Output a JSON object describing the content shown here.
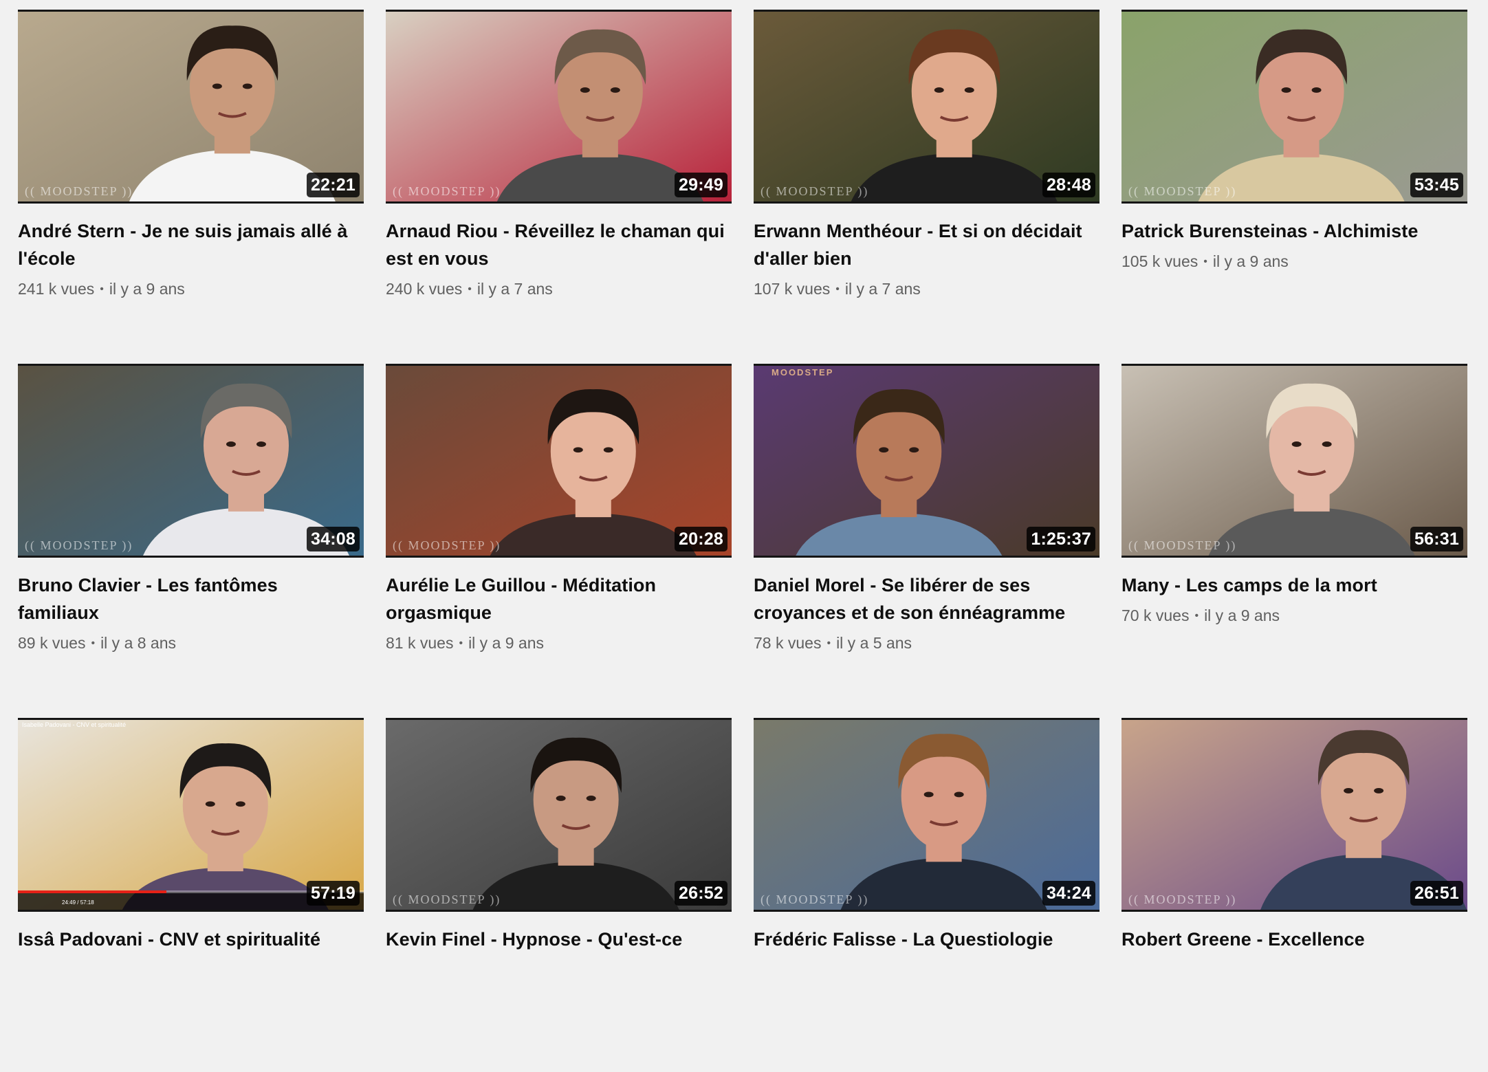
{
  "videos": [
    {
      "title": "André Stern - Je ne suis jamais allé à l'école",
      "views": "241 k vues",
      "age": "il y a 9 ans",
      "duration": "22:21",
      "watermark": "(( MOODSTEP ))",
      "scene": {
        "bg": "#b8a98e",
        "bg2": "#8e836e",
        "skin": "#c99a7c",
        "hair": "#2a1e16",
        "shirt": "#f4f4f4",
        "face_cx": 0.62,
        "face_cy": 0.4
      }
    },
    {
      "title": "Arnaud Riou - Réveillez le chaman qui est en vous",
      "views": "240 k vues",
      "age": "il y a 7 ans",
      "duration": "29:49",
      "watermark": "(( MOODSTEP ))",
      "scene": {
        "bg": "#d8d0c2",
        "bg2": "#b8223a",
        "skin": "#c38f73",
        "hair": "#6d5a49",
        "shirt": "#4a4a4a",
        "face_cx": 0.62,
        "face_cy": 0.42
      }
    },
    {
      "title": "Erwann Menthéour - Et si on décidait d'aller bien",
      "views": "107 k vues",
      "age": "il y a 7 ans",
      "duration": "28:48",
      "watermark": "(( MOODSTEP ))",
      "scene": {
        "bg": "#6b5a3a",
        "bg2": "#2e3a22",
        "skin": "#e0a98c",
        "hair": "#6a3a20",
        "shirt": "#1e1e1e",
        "face_cx": 0.58,
        "face_cy": 0.42
      }
    },
    {
      "title": "Patrick Burensteinas - Alchimiste",
      "views": "105 k vues",
      "age": "il y a 9 ans",
      "duration": "53:45",
      "watermark": "(( MOODSTEP ))",
      "scene": {
        "bg": "#8aa36a",
        "bg2": "#9a9a92",
        "skin": "#d69a86",
        "hair": "#3a2c24",
        "shirt": "#d8c8a0",
        "face_cx": 0.52,
        "face_cy": 0.42
      }
    },
    {
      "title": "Bruno Clavier - Les fantômes familiaux",
      "views": "89 k vues",
      "age": "il y a 8 ans",
      "duration": "34:08",
      "watermark": "(( MOODSTEP ))",
      "scene": {
        "bg": "#5a5242",
        "bg2": "#3a6a8a",
        "skin": "#d8a894",
        "hair": "#6a6a66",
        "shirt": "#e8e8ec",
        "face_cx": 0.66,
        "face_cy": 0.42
      }
    },
    {
      "title": "Aurélie Le Guillou - Méditation orgasmique",
      "views": "81 k vues",
      "age": "il y a 9 ans",
      "duration": "20:28",
      "watermark": "(( MOODSTEP ))",
      "scene": {
        "bg": "#6a4a3a",
        "bg2": "#a8442a",
        "skin": "#e6b49c",
        "hair": "#1e1612",
        "shirt": "#3a2a28",
        "face_cx": 0.6,
        "face_cy": 0.45
      }
    },
    {
      "title": "Daniel Morel - Se libérer de ses croyances et de son énnéagramme",
      "views": "78 k vues",
      "age": "il y a 5 ans",
      "duration": "1:25:37",
      "watermark": "MOODSTEP",
      "scene": {
        "bg": "#5a3a72",
        "bg2": "#4a3a28",
        "skin": "#b87a5a",
        "hair": "#3a2818",
        "shirt": "#6a88a8",
        "face_cx": 0.42,
        "face_cy": 0.45
      }
    },
    {
      "title": "Many - Les camps de la mort",
      "views": "70 k vues",
      "age": "il y a 9 ans",
      "duration": "56:31",
      "watermark": "(( MOODSTEP ))",
      "scene": {
        "bg": "#c8c0b4",
        "bg2": "#6a5a4a",
        "skin": "#e4b8a6",
        "hair": "#e8dcc8",
        "shirt": "#5a5a5a",
        "face_cx": 0.55,
        "face_cy": 0.42
      }
    },
    {
      "title": "Issâ Padovani - CNV et spiritualité",
      "views": "",
      "age": "",
      "duration": "57:19",
      "watermark": "",
      "player": {
        "title": "Isabelle Padovani - CNV et spiritualité",
        "time": "24:49 / 57:18",
        "progress": 0.43
      },
      "scene": {
        "bg": "#e8e4dc",
        "bg2": "#d8a848",
        "skin": "#d8a88e",
        "hair": "#1e1a18",
        "shirt": "#5a4a6a",
        "face_cx": 0.6,
        "face_cy": 0.45
      }
    },
    {
      "title": "Kevin Finel - Hypnose - Qu'est-ce",
      "views": "",
      "age": "",
      "duration": "26:52",
      "watermark": "(( MOODSTEP ))",
      "scene": {
        "bg": "#6a6a6a",
        "bg2": "#3a3a3a",
        "skin": "#c89a82",
        "hair": "#1a1410",
        "shirt": "#1e1e1e",
        "face_cx": 0.55,
        "face_cy": 0.42
      }
    },
    {
      "title": "Frédéric Falisse - La Questiologie",
      "views": "",
      "age": "",
      "duration": "34:24",
      "watermark": "(( MOODSTEP ))",
      "scene": {
        "bg": "#7a7a6a",
        "bg2": "#4a6a9a",
        "skin": "#d89a84",
        "hair": "#8a5a32",
        "shirt": "#222a38",
        "face_cx": 0.55,
        "face_cy": 0.4
      }
    },
    {
      "title": "Robert Greene - Excellence",
      "views": "",
      "age": "",
      "duration": "26:51",
      "watermark": "(( MOODSTEP ))",
      "scene": {
        "bg": "#c8a48a",
        "bg2": "#6a4a8a",
        "skin": "#d8a890",
        "hair": "#4a3a30",
        "shirt": "#34405a",
        "face_cx": 0.7,
        "face_cy": 0.38
      }
    }
  ]
}
